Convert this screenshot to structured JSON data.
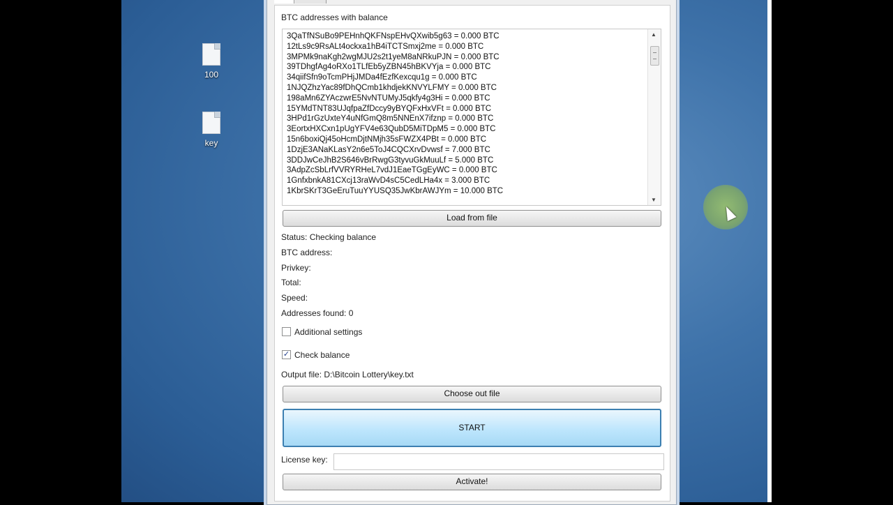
{
  "desktop": {
    "icons": [
      {
        "label": "100"
      },
      {
        "label": "key"
      }
    ]
  },
  "panel": {
    "list_title": "BTC addresses with balance",
    "addresses": [
      "3QaTfNSuBo9PEHnhQKFNspEHvQXwib5g63 = 0.000 BTC",
      "12tLs9c9RsALt4ockxa1hB4iTCTSmxj2me = 0.000 BTC",
      "3MPMk9naKgh2wgMJU2s2t1yeM8aNRkuPJN = 0.000 BTC",
      "39TDhgfAg4oRXo1TLfEb5yZBN45hBKVYja = 0.000 BTC",
      "34qiifSfn9oTcmPHjJMDa4fEzfKexcqu1g = 0.000 BTC",
      "1NJQZhzYac89fDhQCmb1khdjekKNVYLFMY = 0.000 BTC",
      "198aMn6ZYAczwrE5NvNTUMyJ5qkfy4g3Hi = 0.000 BTC",
      "15YMdTNT83UJqfpaZfDccy9yBYQFxHxVFt = 0.000 BTC",
      "3HPd1rGzUxteY4uNfGmQ8m5NNEnX7ifznp = 0.000 BTC",
      "3EortxHXCxn1pUgYFV4e63QubD5MiTDpM5 = 0.000 BTC",
      "15n6boxiQj45oHcmDjtNMjh35sFWZX4PBt = 0.000 BTC",
      "1DzjE3ANaKLasY2n6e5ToJ4CQCXrvDvwsf = 7.000 BTC",
      "3DDJwCeJhB2S646vBrRwgG3tyvuGkMuuLf = 5.000 BTC",
      "3AdpZcSbLrfVVRYRHeL7vdJ1EaeTGgEyWC = 0.000 BTC",
      "1GnfxbnkA81CXcj13raWvD4sC5CedLHa4x = 3.000 BTC",
      "1KbrSKrT3GeEruTuuYYUSQ35JwKbrAWJYm = 10.000 BTC"
    ],
    "load_button": "Load from file",
    "status": "Status: Checking balance",
    "btc_address": "BTC address:",
    "privkey": "Privkey:",
    "total": "Total:",
    "speed": "Speed:",
    "addresses_found": "Addresses found: 0",
    "additional_settings": "Additional settings",
    "additional_settings_checked": false,
    "check_balance": "Check balance",
    "check_balance_checked": true,
    "check_mark": "✓",
    "output_file": "Output file: D:\\Bitcoin Lottery\\key.txt",
    "choose_out_button": "Choose out file",
    "start_button": "START",
    "license_label": "License key:",
    "license_value": "",
    "activate_button": "Activate!"
  },
  "scroll_arrows": {
    "up": "▲",
    "down": "▼"
  }
}
